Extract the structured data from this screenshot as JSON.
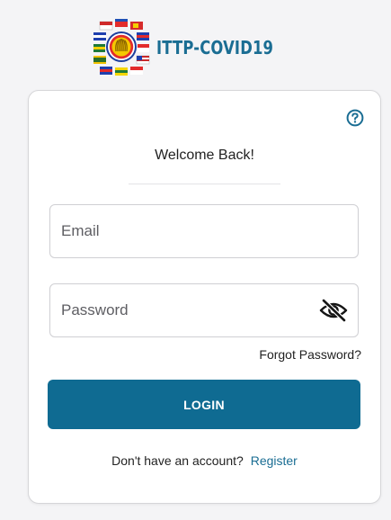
{
  "header": {
    "app_name": "ITTP-COVID19",
    "brand_color": "#1a6d93",
    "logo_icon": "asean-flags-emblem-icon"
  },
  "card": {
    "help_icon": "help-circle-icon",
    "welcome": "Welcome Back!",
    "email_placeholder": "Email",
    "email_value": "",
    "password_placeholder": "Password",
    "password_value": "",
    "password_toggle_icon": "eye-off-icon",
    "forgot_password": "Forgot Password?",
    "login_label": "LOGIN",
    "login_color": "#0f6b92",
    "no_account_text": "Don't have an account?",
    "register_label": "Register"
  }
}
